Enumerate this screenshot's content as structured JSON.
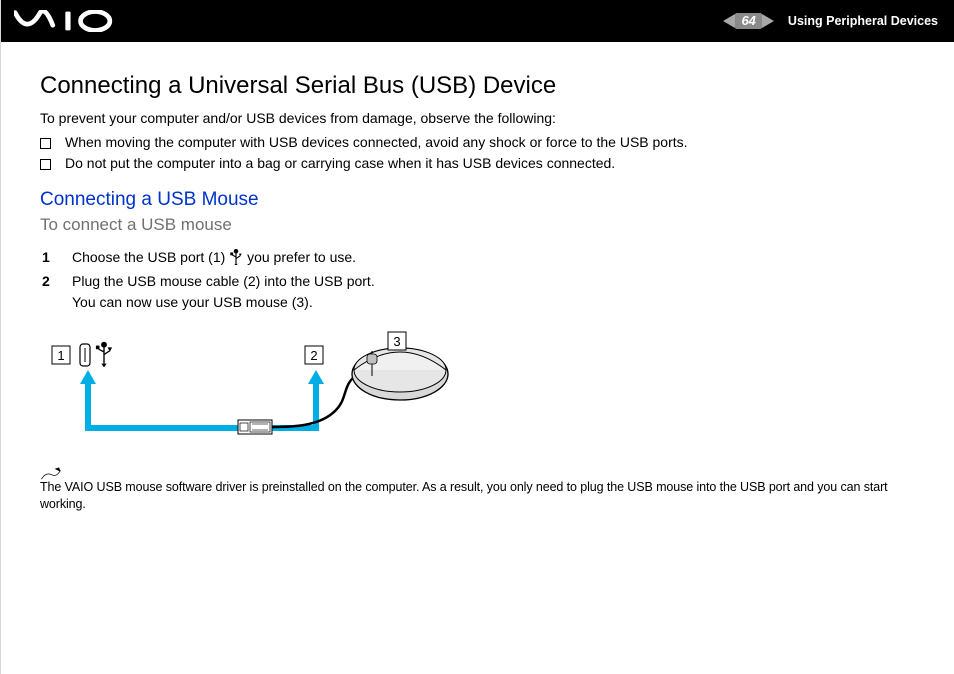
{
  "header": {
    "page_number": "64",
    "section": "Using Peripheral Devices",
    "logo_name": "vaio-logo"
  },
  "title": "Connecting a Universal Serial Bus (USB) Device",
  "intro": "To prevent your computer and/or USB devices from damage, observe the following:",
  "bullets": [
    "When moving the computer with USB devices connected, avoid any shock or force to the USB ports.",
    "Do not put the computer into a bag or carrying case when it has USB devices connected."
  ],
  "subsection_title": "Connecting a USB Mouse",
  "subhead": "To connect a USB mouse",
  "steps": [
    {
      "prefix": "Choose the USB port (1) ",
      "suffix": " you prefer to use."
    },
    {
      "prefix": "Plug the USB mouse cable (2) into the USB port.",
      "suffix": "",
      "line2": "You can now use your USB mouse (3)."
    }
  ],
  "diagram_labels": {
    "port": "1",
    "plug": "2",
    "mouse": "3"
  },
  "note": "The VAIO USB mouse software driver is preinstalled on the computer. As a result, you only need to plug the USB mouse into the USB port and you can start working."
}
